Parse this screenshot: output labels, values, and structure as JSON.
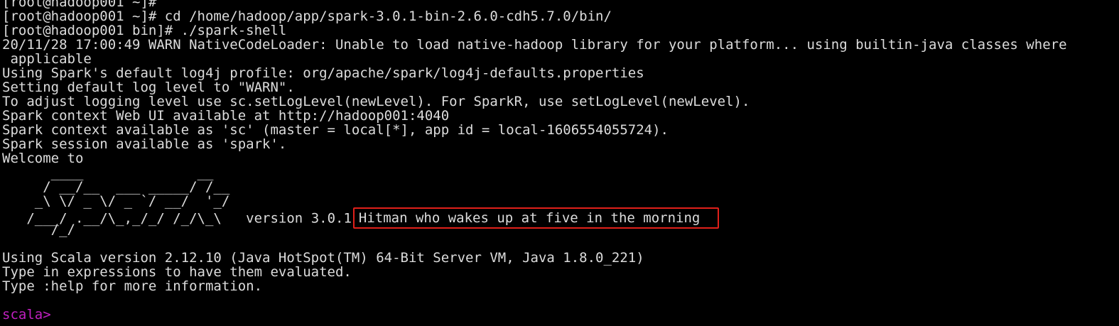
{
  "terminal": {
    "lines_top": [
      "[root@hadoop001 ~]# cd /home/hadoop/app/spark-3.0.1-bin-2.6.0-cdh5.7.0/bin/",
      "[root@hadoop001 bin]# ./spark-shell",
      "20/11/28 17:00:49 WARN NativeCodeLoader: Unable to load native-hadoop library for your platform... using builtin-java classes where",
      " applicable",
      "Using Spark's default log4j profile: org/apache/spark/log4j-defaults.properties",
      "Setting default log level to \"WARN\".",
      "To adjust logging level use sc.setLogLevel(newLevel). For SparkR, use setLogLevel(newLevel).",
      "Spark context Web UI available at http://hadoop001:4040",
      "Spark context available as 'sc' (master = local[*], app id = local-1606554055724).",
      "Spark session available as 'spark'.",
      "Welcome to"
    ],
    "banner": [
      "      ____              __",
      "     / __/__  ___ _____/ /__",
      "    _\\ \\/ _ \\/ _ `/ __/  '_/",
      "   /___/ .__/\\_,_/_/ /_/\\_\\",
      "      /_/"
    ],
    "version_text": "   version 3.0.1",
    "highlight_text": "Hitman who wakes up at five in the morning",
    "lines_bottom": [
      "Using Scala version 2.12.10 (Java HotSpot(TM) 64-Bit Server VM, Java 1.8.0_221)",
      "Type in expressions to have them evaluated.",
      "Type :help for more information."
    ],
    "prompt": "scala>",
    "colors": {
      "background": "#000000",
      "text": "#dcdcdc",
      "prompt": "#c020c0",
      "highlight_border": "#e0201a"
    }
  }
}
